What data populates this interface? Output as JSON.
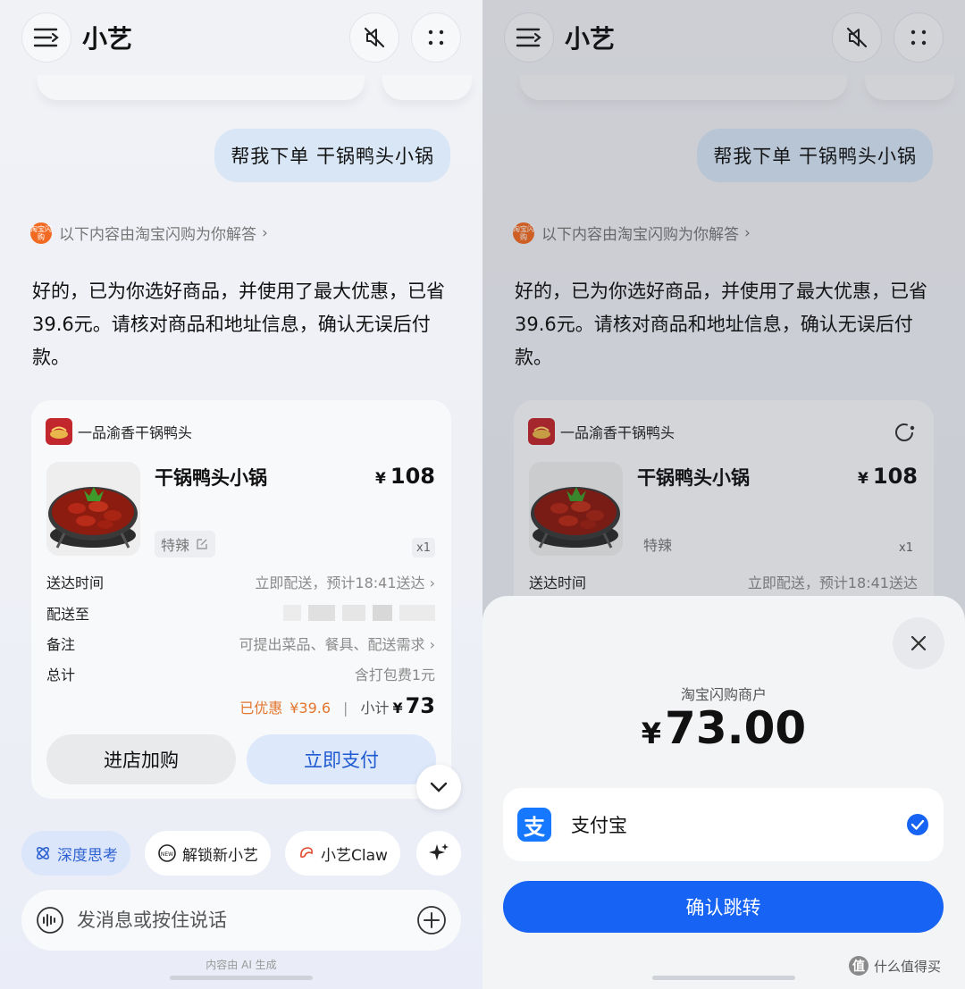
{
  "app": {
    "title": "小艺"
  },
  "user_message": "帮我下单 干锅鸭头小锅",
  "source": {
    "icon_text": "淘宝闪购",
    "label": "以下内容由淘宝闪购为你解答",
    "chevron": "›"
  },
  "answer": "好的，已为你选好商品，并使用了最大优惠，已省39.6元。请核对商品和地址信息，确认无误后付款。",
  "order": {
    "shop_name": "一品渝香干锅鸭头",
    "product_name": "干锅鸭头小锅",
    "currency": "¥",
    "price": "108",
    "spec": "特辣",
    "quantity": "x1",
    "rows": [
      {
        "label": "送达时间",
        "value": "立即配送，预计18:41送达 ›"
      },
      {
        "label": "配送至",
        "value": ""
      },
      {
        "label": "备注",
        "value": "可提出菜品、餐具、配送需求 ›"
      },
      {
        "label": "总计",
        "value": "含打包费1元"
      }
    ],
    "right_delivery_value": "立即配送，预计18:41送达",
    "discount_label": "已优惠",
    "discount_value": "¥39.6",
    "separator": "|",
    "subtotal_label": "小计",
    "subtotal": "73",
    "store_button": "进店加购",
    "pay_button": "立即支付"
  },
  "chips": [
    "深度思考",
    "解锁新小艺",
    "小艺Claw"
  ],
  "input": {
    "placeholder": "发消息或按住说话"
  },
  "ai_note": "内容由 AI 生成",
  "payment": {
    "merchant": "淘宝闪购商户",
    "currency": "¥",
    "amount": "73.00",
    "method": "支付宝",
    "method_logo": "支",
    "confirm": "确认跳转"
  },
  "watermark": {
    "badge": "值",
    "text": "什么值得买"
  },
  "colors": {
    "accent_blue": "#1763f3",
    "discount_orange": "#e3752d",
    "alipay_blue": "#1677ff"
  }
}
